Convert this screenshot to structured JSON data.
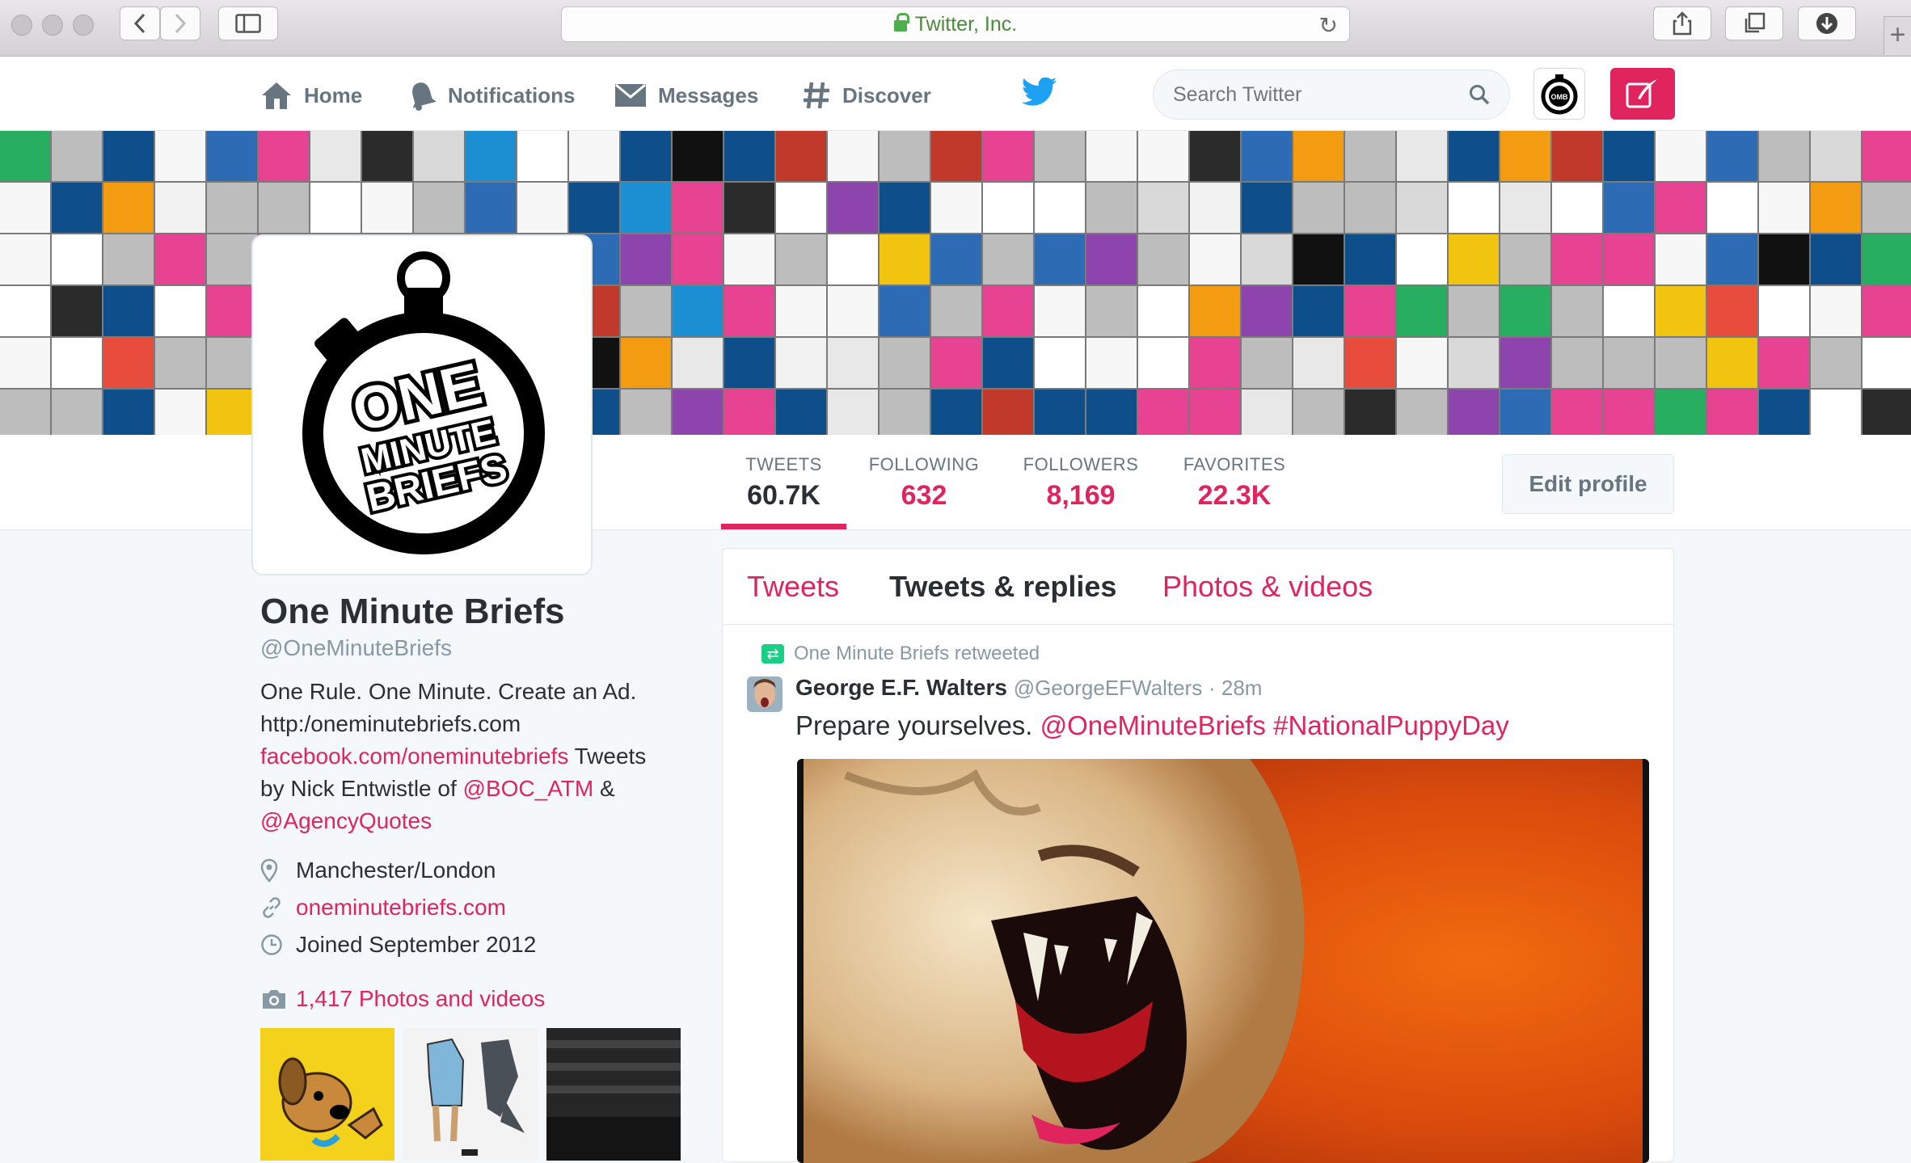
{
  "browser": {
    "url_text": "Twitter, Inc.",
    "back_icon": "chevron-left-icon",
    "forward_icon": "chevron-right-icon"
  },
  "topnav": {
    "home": "Home",
    "notifications": "Notifications",
    "messages": "Messages",
    "discover": "Discover",
    "search_placeholder": "Search Twitter"
  },
  "stats": [
    {
      "label": "TWEETS",
      "value": "60.7K"
    },
    {
      "label": "FOLLOWING",
      "value": "632"
    },
    {
      "label": "FOLLOWERS",
      "value": "8,169"
    },
    {
      "label": "FAVORITES",
      "value": "22.3K"
    }
  ],
  "edit_profile": "Edit profile",
  "avatar_logo": {
    "line1": "ONE",
    "line2": "MINUTE",
    "line3": "BRIEFS"
  },
  "profile": {
    "name": "One Minute Briefs",
    "handle": "@OneMinuteBriefs",
    "bio_line1": "One Rule. One Minute. Create an Ad.",
    "bio_line2": "http:/oneminutebriefs.com",
    "bio_fb_link": "facebook.com/oneminutebriefs",
    "bio_after_fb": " Tweets",
    "bio_by": "by Nick Entwistle of ",
    "bio_boc": "@BOC_ATM",
    "bio_amp": " &",
    "bio_agency": "@AgencyQuotes",
    "location": "Manchester/London",
    "website": "oneminutebriefs.com",
    "joined": "Joined September 2012",
    "photos_count": "1,417 Photos and videos"
  },
  "tabs": [
    "Tweets",
    "Tweets & replies",
    "Photos & videos"
  ],
  "tweet": {
    "retweeted_by": "One Minute Briefs retweeted",
    "author_name": "George E.F. Walters",
    "author_handle": "@GeorgeEFWalters",
    "time": "· 28m",
    "text_plain": "Prepare yourselves. ",
    "mention": "@OneMinuteBriefs",
    "hashtag": "#NationalPuppyDay"
  },
  "colors": {
    "accent": "#e0245e",
    "twitter_blue": "#1da1f2",
    "retweet_green": "#19cf86"
  }
}
